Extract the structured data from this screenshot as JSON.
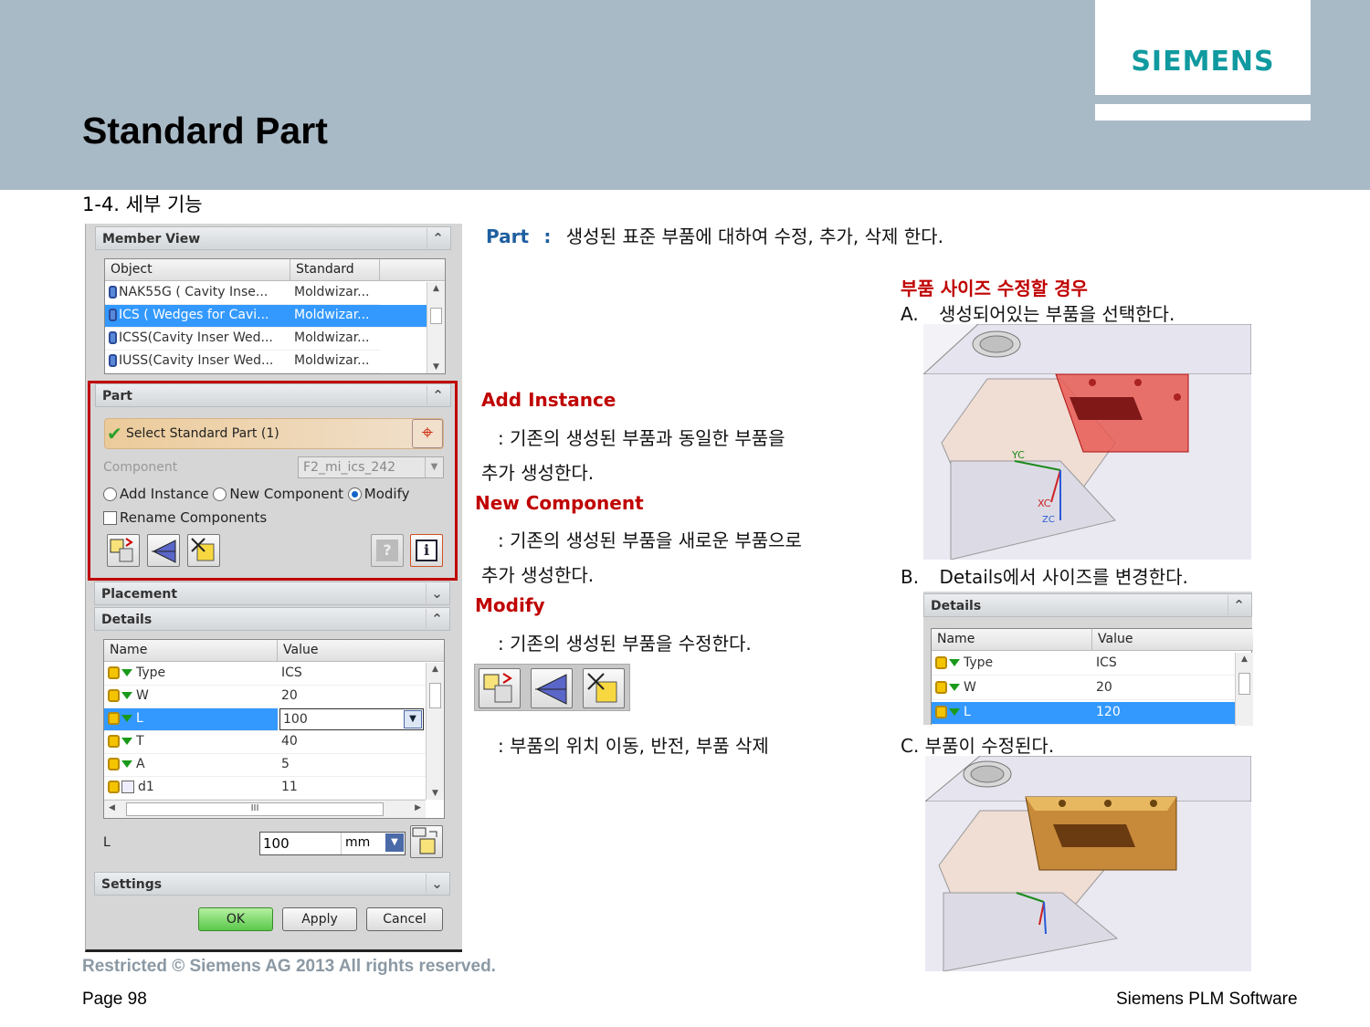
{
  "header": {
    "logo": "SIEMENS",
    "title": "Standard Part",
    "subtitle": "1-4. 세부 기능"
  },
  "dialog": {
    "member_view": {
      "title": "Member View",
      "columns": [
        "Object",
        "Standard"
      ],
      "rows": [
        {
          "object": "NAK55G ( Cavity Inse...",
          "standard": "Moldwizar..."
        },
        {
          "object": "ICS ( Wedges for Cavi...",
          "standard": "Moldwizar...",
          "selected": true
        },
        {
          "object": "ICSS(Cavity Inser Wed...",
          "standard": "Moldwizar..."
        },
        {
          "object": "IUSS(Cavity Inser Wed...",
          "standard": "Moldwizar..."
        }
      ]
    },
    "part": {
      "title": "Part",
      "select_label": "Select Standard Part (1)",
      "component_label": "Component",
      "component_value": "F2_mi_ics_242",
      "radio_add": "Add Instance",
      "radio_new": "New Component",
      "radio_modify": "Modify",
      "rename_label": "Rename Components"
    },
    "placement": {
      "title": "Placement"
    },
    "details": {
      "title": "Details",
      "columns": [
        "Name",
        "Value"
      ],
      "rows": [
        {
          "name": "Type",
          "value": "ICS"
        },
        {
          "name": "W",
          "value": "20"
        },
        {
          "name": "L",
          "value": "100",
          "selected": true
        },
        {
          "name": "T",
          "value": "40"
        },
        {
          "name": "A",
          "value": "5"
        },
        {
          "name": "d1",
          "value": "11"
        }
      ],
      "hscroll": "III",
      "l_label": "L",
      "l_value": "100",
      "l_unit": "mm"
    },
    "settings": {
      "title": "Settings"
    },
    "buttons": {
      "ok": "OK",
      "apply": "Apply",
      "cancel": "Cancel"
    }
  },
  "content": {
    "part_label": "Part",
    "part_sep": ":",
    "part_desc": "생성된 표준 부품에 대하여 수정, 추가, 삭제 한다.",
    "add_title": "Add Instance",
    "add_line1": ": 기존의 생성된 부품과 동일한 부품을",
    "add_line2": "추가 생성한다.",
    "new_title": "New Component",
    "new_line1": ": 기존의 생성된 부품을 새로운 부품으로",
    "new_line2": "추가 생성한다.",
    "modify_title": "Modify",
    "modify_line1": ": 기존의 생성된 부품을 수정한다.",
    "toolbar_desc": ": 부품의 위치 이동, 반전, 부품 삭제",
    "case_title": "부품 사이즈 수정할 경우",
    "step_a_marker": "A.",
    "step_a_text": "생성되어있는 부품을 선택한다.",
    "step_b_marker": "B.",
    "step_b_text": "Details에서 사이즈를 변경한다.",
    "step_c": "C. 부품이 수정된다.",
    "details_panel": {
      "title": "Details",
      "columns": [
        "Name",
        "Value"
      ],
      "rows": [
        {
          "name": "Type",
          "value": "ICS"
        },
        {
          "name": "W",
          "value": "20"
        },
        {
          "name": "L",
          "value": "120",
          "selected": true
        }
      ]
    },
    "axis_labels": {
      "yc": "YC",
      "xc": "XC",
      "zc": "ZC"
    }
  },
  "footer": {
    "restricted": "Restricted © Siemens AG 2013 All rights reserved.",
    "page": "Page 98",
    "brand": "Siemens PLM Software"
  },
  "colors": {
    "header_bg": "#a9bac7",
    "logo": "#109aa0",
    "accent_red": "#c00000",
    "accent_blue": "#1f5fa0",
    "selection": "#3399ff"
  }
}
